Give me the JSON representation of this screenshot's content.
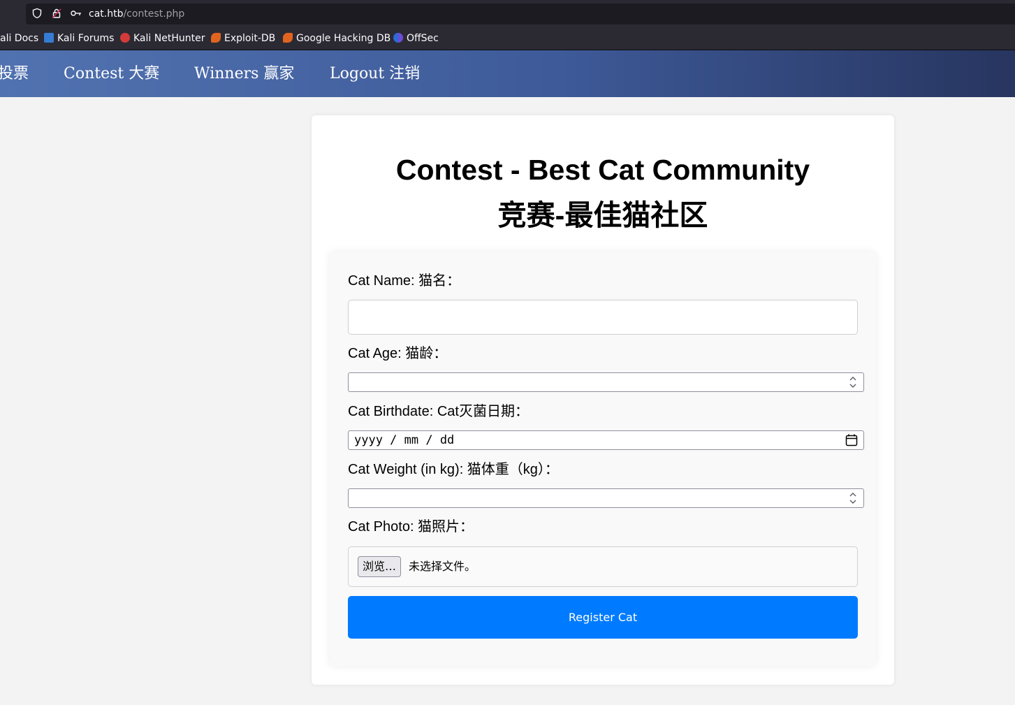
{
  "browser": {
    "url_host": "cat.htb",
    "url_path": "/contest.php",
    "bookmarks": [
      {
        "label": "ali Docs",
        "icon": "kali-docs-icon"
      },
      {
        "label": "Kali Forums",
        "icon": "kali-forums-icon"
      },
      {
        "label": "Kali NetHunter",
        "icon": "kali-nethunter-icon"
      },
      {
        "label": "Exploit-DB",
        "icon": "exploit-db-icon"
      },
      {
        "label": "Google Hacking DB",
        "icon": "ghdb-icon"
      },
      {
        "label": "OffSec",
        "icon": "offsec-icon"
      }
    ]
  },
  "nav": {
    "items": [
      {
        "label": "投票"
      },
      {
        "label": "Contest 大赛"
      },
      {
        "label": "Winners 赢家"
      },
      {
        "label": "Logout 注销"
      }
    ]
  },
  "page": {
    "title_en": "Contest - Best Cat Community",
    "title_zh": "竞赛-最佳猫社区"
  },
  "form": {
    "name_label": "Cat Name: 猫名：",
    "name_value": "",
    "age_label": "Cat Age: 猫龄：",
    "age_value": "",
    "birthdate_label": "Cat Birthdate: Cat灭菌日期：",
    "birthdate_placeholder": "yyyy / mm / dd",
    "weight_label": "Cat Weight (in kg): 猫体重（kg）：",
    "weight_value": "",
    "photo_label": "Cat Photo: 猫照片：",
    "browse_label": "浏览…",
    "file_status": "未选择文件。",
    "submit_label": "Register Cat"
  },
  "colors": {
    "submit_button": "#007bff",
    "nav_gradient_start": "#5172b0",
    "nav_gradient_end": "#27355f",
    "page_background": "#f3f3f3"
  }
}
